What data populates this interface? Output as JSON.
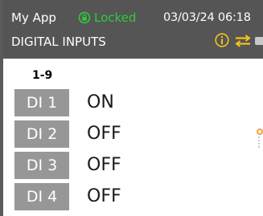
{
  "status_bar": {
    "app_name": "My App",
    "lock_status": "Locked",
    "datetime": "03/03/24 06:18",
    "page_title": "DIGITAL INPUTS"
  },
  "icons": {
    "lock": "lock-icon",
    "info": "info-icon",
    "swap": "swap-arrows-icon",
    "battery": "battery-icon"
  },
  "colors": {
    "status_bar_bg": "#555555",
    "locked_green": "#2ecc3a",
    "info_yellow": "#f5c518",
    "label_bg": "#979797"
  },
  "inputs": {
    "group_label": "1-9",
    "rows": [
      {
        "label": "DI 1",
        "value": "ON"
      },
      {
        "label": "DI 2",
        "value": "OFF"
      },
      {
        "label": "DI 3",
        "value": "OFF"
      },
      {
        "label": "DI 4",
        "value": "OFF"
      }
    ]
  }
}
